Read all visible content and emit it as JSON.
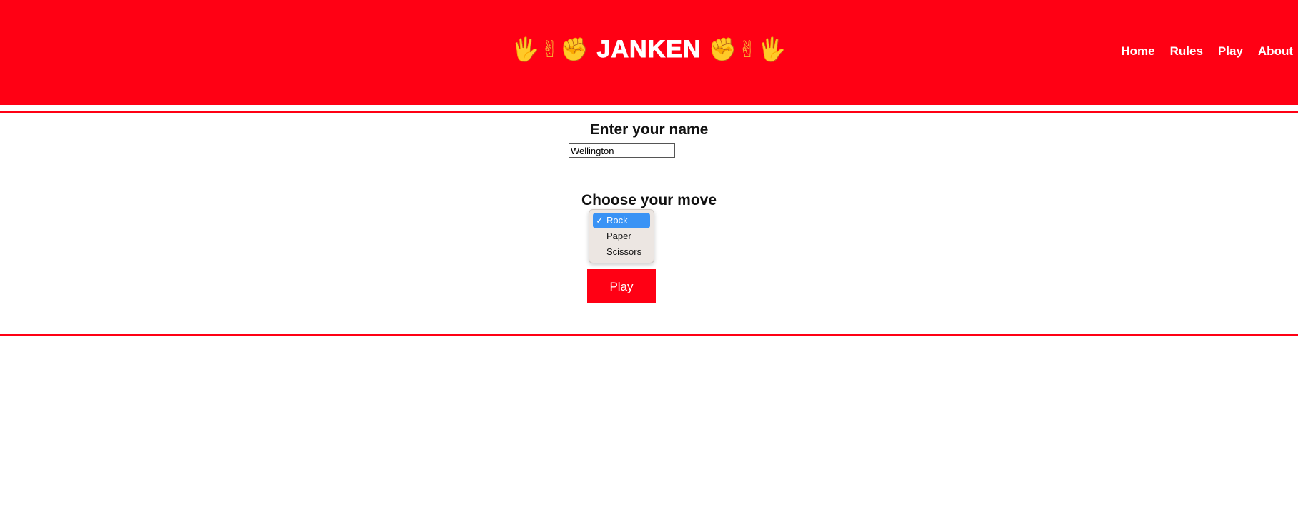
{
  "header": {
    "title_emoji_left": "🖐✌✊",
    "title_text": "JANKEN",
    "title_emoji_right": "✊✌🖐",
    "nav": [
      {
        "label": "Home"
      },
      {
        "label": "Rules"
      },
      {
        "label": "Play"
      },
      {
        "label": "About"
      }
    ],
    "background_color": "#ff0014"
  },
  "form": {
    "name_label": "Enter your name",
    "name_value": "Wellington",
    "move_label": "Choose your move",
    "move_options": [
      {
        "label": "Rock",
        "selected": true,
        "check": "✓"
      },
      {
        "label": "Paper",
        "selected": false,
        "check": ""
      },
      {
        "label": "Scissors",
        "selected": false,
        "check": ""
      }
    ],
    "play_label": "Play"
  },
  "colors": {
    "accent": "#ff0014",
    "selection": "#3a93f5"
  }
}
